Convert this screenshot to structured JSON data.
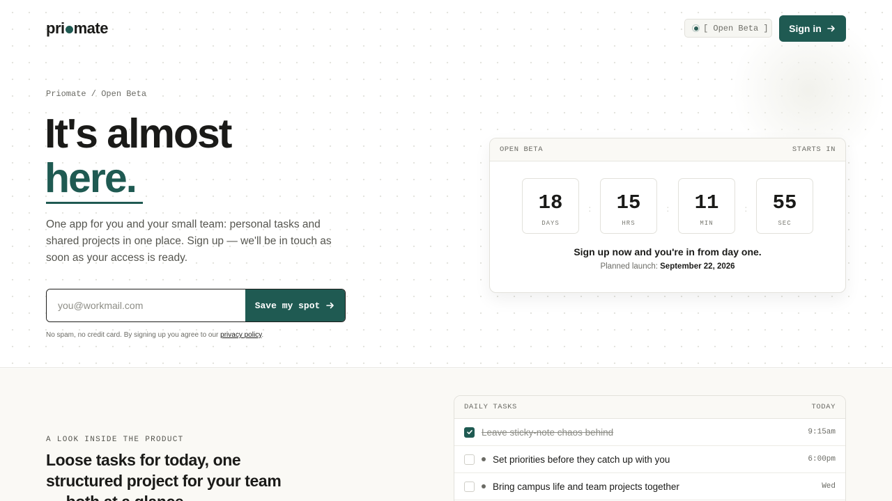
{
  "header": {
    "logo": "pri",
    "logo_tail": "mate",
    "beta_badge": "[ Open Beta ]",
    "signin_label": "Sign in"
  },
  "hero": {
    "breadcrumb": "Priomate / Open Beta",
    "headline_line1": "It's almost",
    "headline_line2": "here.",
    "lead": "One app for you and your small team: personal tasks and shared projects in one place. Sign up — we'll be in touch as soon as your access is ready.",
    "email_placeholder": "you@workmail.com",
    "email_value": "",
    "cta_label": "Save my spot",
    "fine_print": "No spam, no credit card. By signing up you agree to our ",
    "privacy_link": "privacy policy",
    "fine_print_end": "."
  },
  "countdown": {
    "label_left": "OPEN BETA",
    "label_right": "STARTS IN",
    "units": [
      {
        "value": "18",
        "label": "DAYS"
      },
      {
        "value": "15",
        "label": "HRS"
      },
      {
        "value": "11",
        "label": "MIN"
      },
      {
        "value": "55",
        "label": "SEC"
      }
    ],
    "message": "Sign up now and you're in from day one.",
    "launch_prefix": "Planned launch: ",
    "launch_date": "September 22, 2026"
  },
  "product": {
    "eyebrow": "A LOOK INSIDE THE PRODUCT",
    "title": "Loose tasks for today, one structured project for your team — both at a glance."
  },
  "tasks": {
    "header_left": "DAILY TASKS",
    "header_right": "TODAY",
    "items": [
      {
        "text": "Leave sticky-note chaos behind",
        "time": "9:15am",
        "done": true
      },
      {
        "text": "Set priorities before they catch up with you",
        "time": "6:00pm",
        "done": false
      },
      {
        "text": "Bring campus life and team projects together",
        "time": "Wed",
        "done": false
      }
    ]
  },
  "colors": {
    "accent": "#1f5a52",
    "text": "#1a1a18",
    "muted": "#6b6b65",
    "lower_bg": "#faf9f5"
  },
  "icons": [
    "arrow-right-icon",
    "check-icon",
    "status-dot-icon"
  ]
}
